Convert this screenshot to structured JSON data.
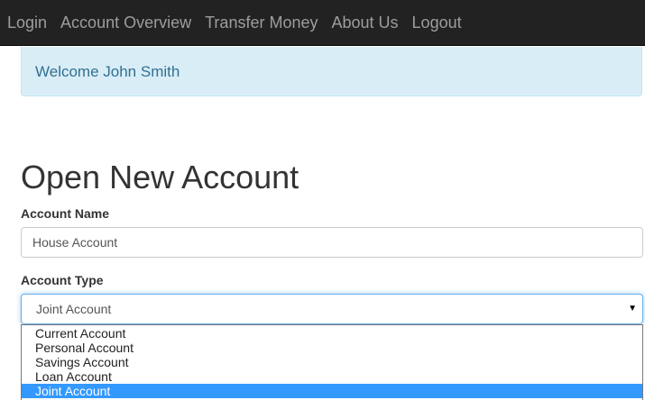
{
  "nav": {
    "items": [
      {
        "label": "Login"
      },
      {
        "label": "Account Overview"
      },
      {
        "label": "Transfer Money"
      },
      {
        "label": "About Us"
      },
      {
        "label": "Logout"
      }
    ]
  },
  "alert": {
    "text": "Welcome John Smith"
  },
  "form": {
    "title": "Open New Account",
    "account_name": {
      "label": "Account Name",
      "value": "House Account"
    },
    "account_type": {
      "label": "Account Type",
      "selected": "Joint Account",
      "options": [
        {
          "label": "Current Account"
        },
        {
          "label": "Personal Account"
        },
        {
          "label": "Savings Account"
        },
        {
          "label": "Loan Account"
        },
        {
          "label": "Joint Account"
        }
      ]
    }
  },
  "colors": {
    "navbar_bg": "#222222",
    "nav_text": "#9d9d9d",
    "alert_bg": "#d9edf7",
    "alert_text": "#31708f",
    "option_highlight": "#3399ff"
  }
}
